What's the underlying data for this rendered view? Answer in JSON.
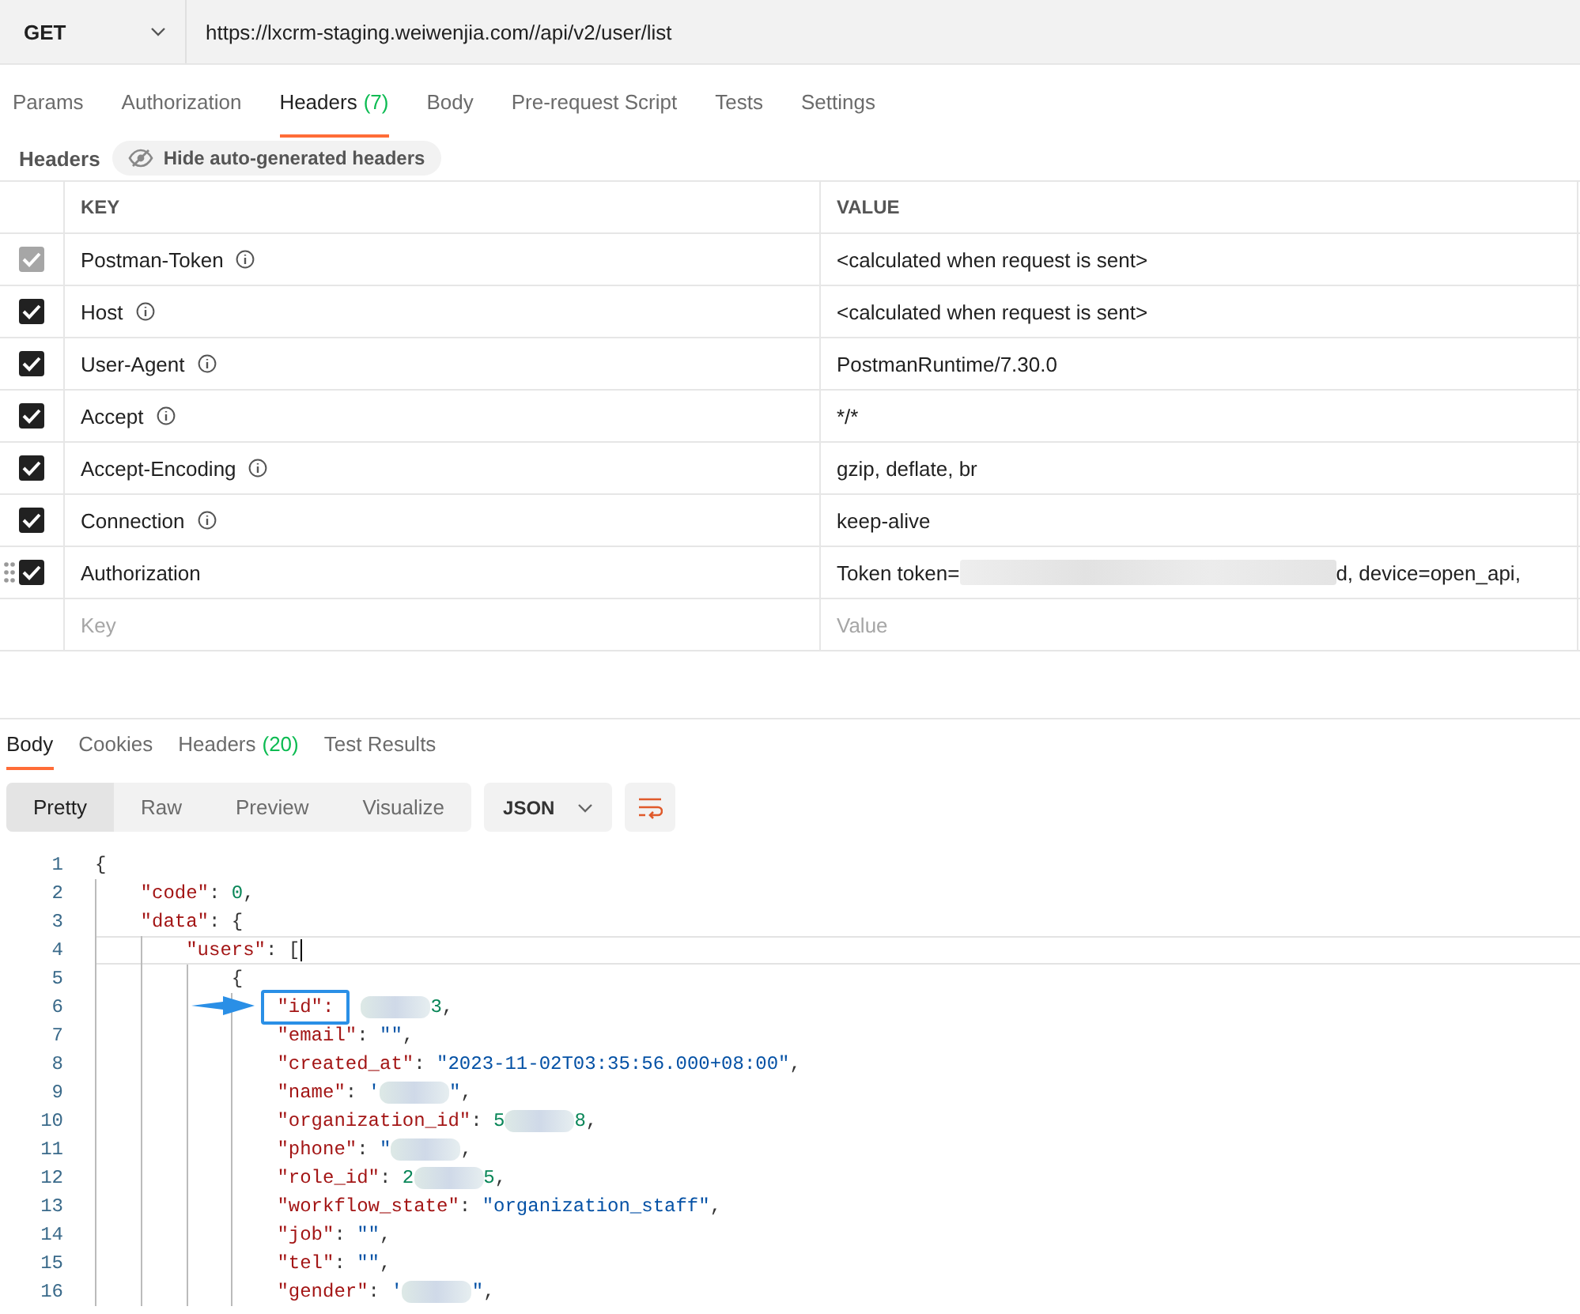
{
  "request": {
    "method": "GET",
    "url": "https://lxcrm-staging.weiwenjia.com//api/v2/user/list"
  },
  "request_tabs": [
    {
      "label": "Params",
      "selected": false
    },
    {
      "label": "Authorization",
      "selected": false
    },
    {
      "label": "Headers",
      "count": "(7)",
      "selected": true
    },
    {
      "label": "Body",
      "selected": false
    },
    {
      "label": "Pre-request Script",
      "selected": false
    },
    {
      "label": "Tests",
      "selected": false
    },
    {
      "label": "Settings",
      "selected": false
    }
  ],
  "headers_bar": {
    "title": "Headers",
    "toggle": "Hide auto-generated headers"
  },
  "headers_table": {
    "columns": [
      "KEY",
      "VALUE"
    ],
    "rows": [
      {
        "checked": true,
        "disabled": true,
        "drag_handle": false,
        "info": true,
        "key": "Postman-Token",
        "value": [
          {
            "kind": "text",
            "text": "<calculated when request is sent>"
          }
        ]
      },
      {
        "checked": true,
        "disabled": false,
        "drag_handle": false,
        "info": true,
        "key": "Host",
        "value": [
          {
            "kind": "text",
            "text": "<calculated when request is sent>"
          }
        ]
      },
      {
        "checked": true,
        "disabled": false,
        "drag_handle": false,
        "info": true,
        "key": "User-Agent",
        "value": [
          {
            "kind": "text",
            "text": "PostmanRuntime/7.30.0"
          }
        ]
      },
      {
        "checked": true,
        "disabled": false,
        "drag_handle": false,
        "info": true,
        "key": "Accept",
        "value": [
          {
            "kind": "text",
            "text": "*/*"
          }
        ]
      },
      {
        "checked": true,
        "disabled": false,
        "drag_handle": false,
        "info": true,
        "key": "Accept-Encoding",
        "value": [
          {
            "kind": "text",
            "text": "gzip, deflate, br"
          }
        ]
      },
      {
        "checked": true,
        "disabled": false,
        "drag_handle": false,
        "info": true,
        "key": "Connection",
        "value": [
          {
            "kind": "text",
            "text": "keep-alive"
          }
        ]
      },
      {
        "checked": true,
        "disabled": false,
        "drag_handle": true,
        "info": false,
        "key": "Authorization",
        "value": [
          {
            "kind": "text",
            "text": "Token token="
          },
          {
            "kind": "redacted"
          },
          {
            "kind": "text",
            "text": "d, device=open_api,"
          }
        ]
      }
    ],
    "new_row": {
      "key_placeholder": "Key",
      "value_placeholder": "Value"
    }
  },
  "response_tabs": [
    {
      "label": "Body",
      "selected": true
    },
    {
      "label": "Cookies",
      "selected": false
    },
    {
      "label": "Headers",
      "count": "(20)",
      "selected": false
    },
    {
      "label": "Test Results",
      "selected": false
    }
  ],
  "view_modes": [
    {
      "label": "Pretty",
      "selected": true
    },
    {
      "label": "Raw",
      "selected": false
    },
    {
      "label": "Preview",
      "selected": false
    },
    {
      "label": "Visualize",
      "selected": false
    }
  ],
  "format": "JSON",
  "code": [
    {
      "n": "1",
      "current": false,
      "segments": [
        {
          "kind": "punct",
          "text": "{"
        }
      ],
      "children": [
        {
          "n": "2",
          "current": false,
          "segments": [
            {
              "kind": "key",
              "text": "\"code\""
            },
            {
              "kind": "punct",
              "text": ": "
            },
            {
              "kind": "num",
              "text": "0"
            },
            {
              "kind": "punct",
              "text": ","
            }
          ]
        },
        {
          "n": "3",
          "current": false,
          "segments": [
            {
              "kind": "key",
              "text": "\"data\""
            },
            {
              "kind": "punct",
              "text": ": {"
            }
          ],
          "children": [
            {
              "n": "4",
              "current": true,
              "segments": [
                {
                  "kind": "key",
                  "text": "\"users\""
                },
                {
                  "kind": "punct",
                  "text": ": ["
                }
              ],
              "children": [
                {
                  "n": "5",
                  "current": false,
                  "segments": [
                    {
                      "kind": "punct",
                      "text": "{"
                    }
                  ],
                  "children": [
                    {
                      "n": "6",
                      "current": false,
                      "segments": [
                        {
                          "kind": "key",
                          "text": "\"id\":",
                          "boxed": true
                        },
                        {
                          "kind": "redacted"
                        },
                        {
                          "kind": "num",
                          "text": "3"
                        },
                        {
                          "kind": "punct",
                          "text": ","
                        }
                      ]
                    },
                    {
                      "n": "7",
                      "current": false,
                      "segments": [
                        {
                          "kind": "key",
                          "text": "\"email\""
                        },
                        {
                          "kind": "punct",
                          "text": ": "
                        },
                        {
                          "kind": "str",
                          "text": "\"\""
                        },
                        {
                          "kind": "punct",
                          "text": ","
                        }
                      ]
                    },
                    {
                      "n": "8",
                      "current": false,
                      "segments": [
                        {
                          "kind": "key",
                          "text": "\"created_at\""
                        },
                        {
                          "kind": "punct",
                          "text": ": "
                        },
                        {
                          "kind": "str",
                          "text": "\"2023-11-02T03:35:56.000+08:00\""
                        },
                        {
                          "kind": "punct",
                          "text": ","
                        }
                      ]
                    },
                    {
                      "n": "9",
                      "current": false,
                      "segments": [
                        {
                          "kind": "key",
                          "text": "\"name\""
                        },
                        {
                          "kind": "punct",
                          "text": ": "
                        },
                        {
                          "kind": "str",
                          "text": "'"
                        },
                        {
                          "kind": "redacted"
                        },
                        {
                          "kind": "str",
                          "text": "\""
                        },
                        {
                          "kind": "punct",
                          "text": ","
                        }
                      ]
                    },
                    {
                      "n": "10",
                      "current": false,
                      "segments": [
                        {
                          "kind": "key",
                          "text": "\"organization_id\""
                        },
                        {
                          "kind": "punct",
                          "text": ": "
                        },
                        {
                          "kind": "num",
                          "text": "5"
                        },
                        {
                          "kind": "redacted"
                        },
                        {
                          "kind": "num",
                          "text": "8"
                        },
                        {
                          "kind": "punct",
                          "text": ","
                        }
                      ]
                    },
                    {
                      "n": "11",
                      "current": false,
                      "segments": [
                        {
                          "kind": "key",
                          "text": "\"phone\""
                        },
                        {
                          "kind": "punct",
                          "text": ": "
                        },
                        {
                          "kind": "str",
                          "text": "\""
                        },
                        {
                          "kind": "redacted"
                        },
                        {
                          "kind": "punct",
                          "text": ","
                        }
                      ]
                    },
                    {
                      "n": "12",
                      "current": false,
                      "segments": [
                        {
                          "kind": "key",
                          "text": "\"role_id\""
                        },
                        {
                          "kind": "punct",
                          "text": ": "
                        },
                        {
                          "kind": "num",
                          "text": "2"
                        },
                        {
                          "kind": "redacted"
                        },
                        {
                          "kind": "num",
                          "text": "5"
                        },
                        {
                          "kind": "punct",
                          "text": ","
                        }
                      ]
                    },
                    {
                      "n": "13",
                      "current": false,
                      "segments": [
                        {
                          "kind": "key",
                          "text": "\"workflow_state\""
                        },
                        {
                          "kind": "punct",
                          "text": ": "
                        },
                        {
                          "kind": "str",
                          "text": "\"organization_staff\""
                        },
                        {
                          "kind": "punct",
                          "text": ","
                        }
                      ]
                    },
                    {
                      "n": "14",
                      "current": false,
                      "segments": [
                        {
                          "kind": "key",
                          "text": "\"job\""
                        },
                        {
                          "kind": "punct",
                          "text": ": "
                        },
                        {
                          "kind": "str",
                          "text": "\"\""
                        },
                        {
                          "kind": "punct",
                          "text": ","
                        }
                      ]
                    },
                    {
                      "n": "15",
                      "current": false,
                      "segments": [
                        {
                          "kind": "key",
                          "text": "\"tel\""
                        },
                        {
                          "kind": "punct",
                          "text": ": "
                        },
                        {
                          "kind": "str",
                          "text": "\"\""
                        },
                        {
                          "kind": "punct",
                          "text": ","
                        }
                      ]
                    },
                    {
                      "n": "16",
                      "current": false,
                      "segments": [
                        {
                          "kind": "key",
                          "text": "\"gender\""
                        },
                        {
                          "kind": "punct",
                          "text": ": "
                        },
                        {
                          "kind": "str",
                          "text": "'"
                        },
                        {
                          "kind": "redacted"
                        },
                        {
                          "kind": "str",
                          "text": "\""
                        },
                        {
                          "kind": "punct",
                          "text": ","
                        }
                      ]
                    }
                  ]
                }
              ]
            }
          ]
        }
      ]
    }
  ]
}
